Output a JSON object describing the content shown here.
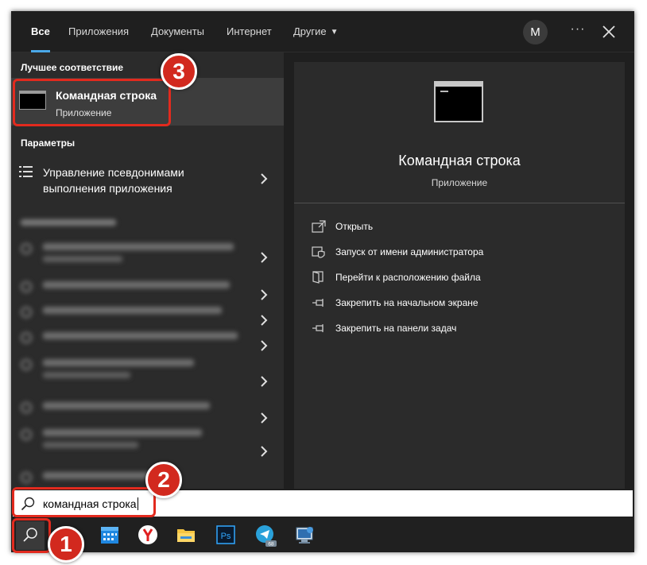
{
  "tabs": [
    {
      "label": "Все",
      "active": true
    },
    {
      "label": "Приложения"
    },
    {
      "label": "Документы"
    },
    {
      "label": "Интернет"
    },
    {
      "label": "Другие"
    }
  ],
  "account": {
    "initial": "M"
  },
  "window_controls": {
    "more": "···"
  },
  "left": {
    "best_match_title": "Лучшее соответствие",
    "best_match": {
      "title": "Командная строка",
      "subtitle": "Приложение",
      "icon": "cmd-icon"
    },
    "settings_title": "Параметры",
    "settings_item": {
      "label": "Управление псевдонимами выполнения приложения",
      "icon": "list-icon"
    }
  },
  "right": {
    "title": "Командная строка",
    "subtitle": "Приложение",
    "actions": [
      {
        "label": "Открыть",
        "icon": "open-icon"
      },
      {
        "label": "Запуск от имени администратора",
        "icon": "shield-icon"
      },
      {
        "label": "Перейти к расположению файла",
        "icon": "folder-icon"
      },
      {
        "label": "Закрепить на начальном экране",
        "icon": "pin-icon"
      },
      {
        "label": "Закрепить на панели задач",
        "icon": "pin-icon"
      }
    ]
  },
  "search": {
    "value": "командная строка"
  },
  "taskbar": {
    "apps": [
      "calendar-icon",
      "yandex-browser-icon",
      "file-explorer-icon",
      "photoshop-icon",
      "telegram-icon",
      "remote-desktop-icon"
    ],
    "telegram_badge": "68"
  },
  "callouts": {
    "one": "1",
    "two": "2",
    "three": "3"
  },
  "colors": {
    "accent": "#4aa8e8",
    "highlight": "#e22a1e",
    "panel": "#2b2b2b"
  }
}
